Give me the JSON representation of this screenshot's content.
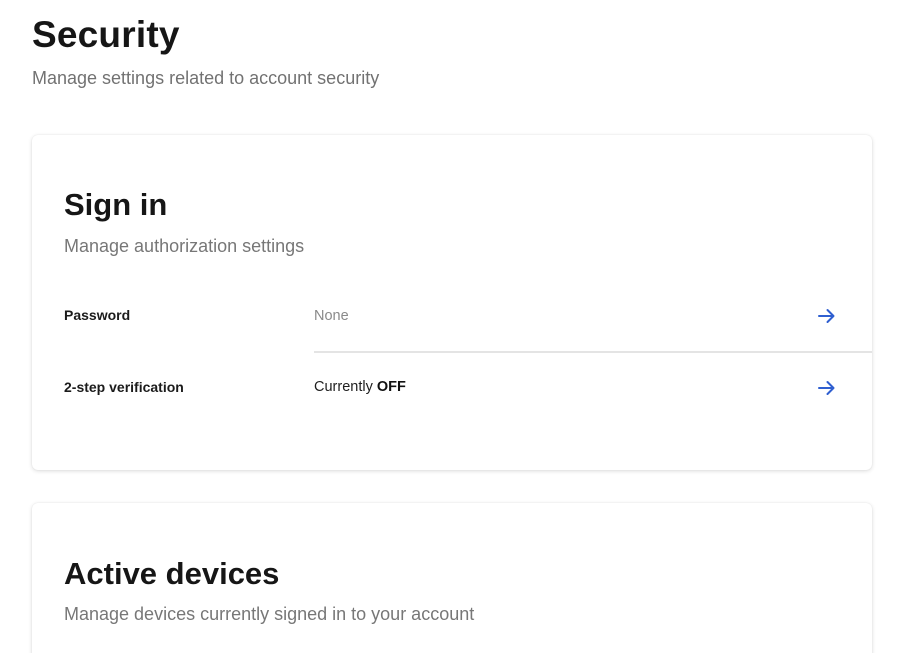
{
  "page": {
    "title": "Security",
    "subtitle": "Manage settings related to account security"
  },
  "sign_in_card": {
    "title": "Sign in",
    "subtitle": "Manage authorization settings",
    "rows": [
      {
        "label": "Password",
        "value": "None",
        "icon": "arrow-right-icon"
      },
      {
        "label": "2-step verification",
        "value_prefix": "Currently",
        "value_status": "OFF",
        "icon": "arrow-right-icon"
      }
    ]
  },
  "active_devices_card": {
    "title": "Active devices",
    "subtitle": "Manage devices currently signed in to your account"
  },
  "colors": {
    "accent": "#2f5fd0",
    "muted_text": "#777777",
    "divider": "#e4e4e4"
  }
}
